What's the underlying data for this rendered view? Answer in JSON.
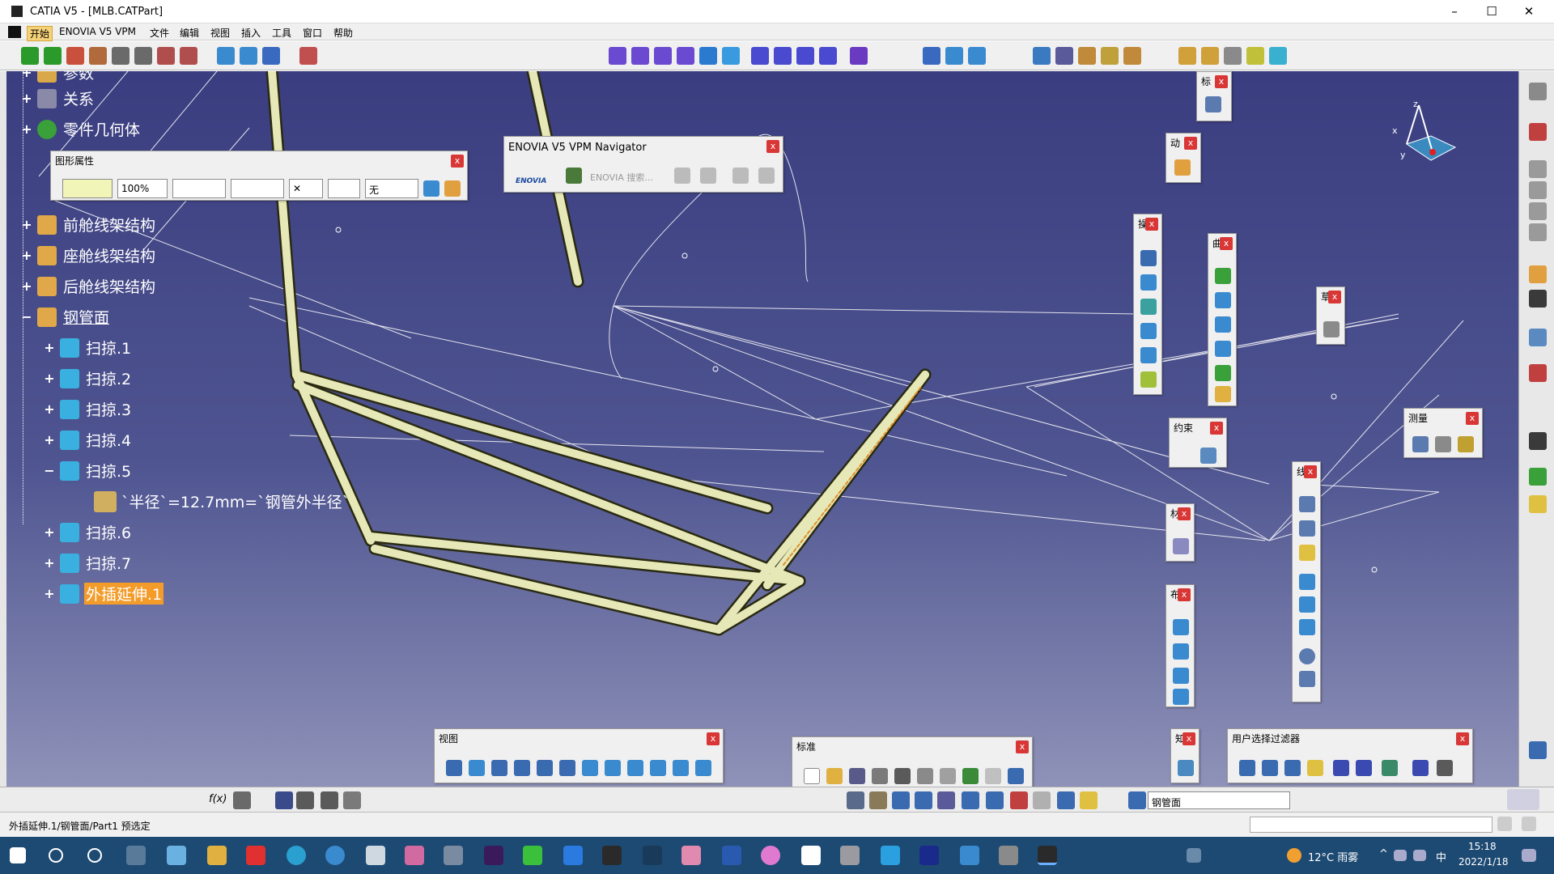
{
  "window": {
    "title": "CATIA V5 - [MLB.CATPart]",
    "min": "–",
    "max": "☐",
    "close": "✕"
  },
  "menu": {
    "items": [
      "开始",
      "ENOVIA V5 VPM",
      "文件",
      "编辑",
      "视图",
      "插入",
      "工具",
      "窗口",
      "帮助"
    ]
  },
  "tree": {
    "top_partial": "参数",
    "relations": "关系",
    "part_body": "零件几何体",
    "front_frame": "前舱线架结构",
    "seat_frame": "座舱线架结构",
    "rear_frame": "后舱线架结构",
    "tube_surface": "钢管面",
    "sweeps": [
      "扫掠.1",
      "扫掠.2",
      "扫掠.3",
      "扫掠.4",
      "扫掠.5"
    ],
    "parameter": "`半径`=12.7mm=`钢管外半径`",
    "sweeps2": [
      "扫掠.6",
      "扫掠.7"
    ],
    "extrapolate": "外插延伸.1"
  },
  "graphic_props": {
    "title": "图形属性",
    "zoom": "100%",
    "layer": "无",
    "close": "x"
  },
  "enovia": {
    "title": "ENOVIA V5 VPM Navigator",
    "search": "ENOVIA 搜索...",
    "logo": "ENOVIA",
    "close": "x"
  },
  "panels": {
    "label1": "标",
    "label2": "动",
    "label3": "操",
    "label4": "曲",
    "label5": "草",
    "constraint": "约束",
    "measure": "测量",
    "label6": "线",
    "label7": "材",
    "label8": "布",
    "label9": "知",
    "view": "视图",
    "standard": "标准",
    "user_filter": "用户选择过滤器",
    "close": "x"
  },
  "bottombar": {
    "current_set": "钢管面",
    "fx": "f(x)"
  },
  "status": {
    "text": "外插延伸.1/钢管面/Part1 预选定"
  },
  "taskbar": {
    "weather": "12°C 雨雾",
    "time": "15:18",
    "date": "2022/1/18",
    "ime": "中"
  },
  "compass": {
    "x": "x",
    "y": "y",
    "z": "z"
  },
  "colors": {
    "viewport_top": "#3a3d7f",
    "viewport_bottom": "#8f92b8",
    "tube": "#e6e8b8",
    "selection": "#f39c2a",
    "close_red": "#d93636"
  }
}
